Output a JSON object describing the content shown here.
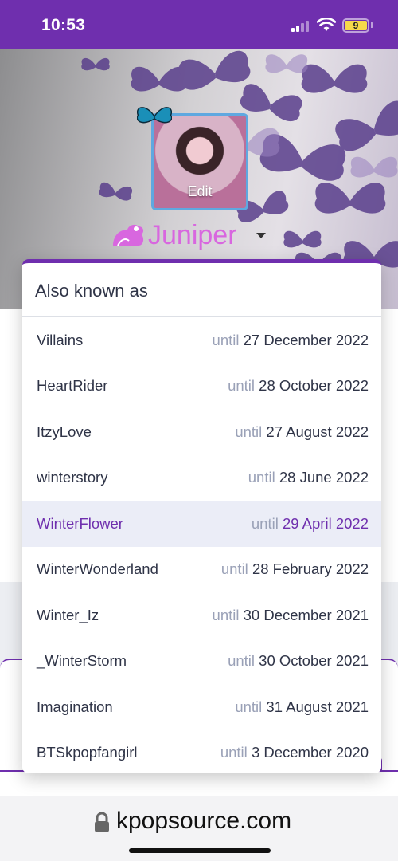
{
  "status_bar": {
    "time": "10:53",
    "battery_level": "9"
  },
  "profile": {
    "avatar_edit_label": "Edit",
    "username": "Juniper",
    "username_color": "#d867df"
  },
  "aka_dropdown": {
    "title": "Also known as",
    "until_word": "until",
    "accent_color": "#6f2fae",
    "items": [
      {
        "name": "Villains",
        "date": "27 December 2022",
        "active": false
      },
      {
        "name": "HeartRider",
        "date": "28 October 2022",
        "active": false
      },
      {
        "name": "ItzyLove",
        "date": "27 August 2022",
        "active": false
      },
      {
        "name": "winterstory",
        "date": "28 June 2022",
        "active": false
      },
      {
        "name": "WinterFlower",
        "date": "29 April 2022",
        "active": true
      },
      {
        "name": "WinterWonderland",
        "date": "28 February 2022",
        "active": false
      },
      {
        "name": "Winter_Iz",
        "date": "30 December 2021",
        "active": false
      },
      {
        "name": "_WinterStorm",
        "date": "30 October 2021",
        "active": false
      },
      {
        "name": "Imagination",
        "date": "31 August 2021",
        "active": false
      },
      {
        "name": "BTSkpopfangirl",
        "date": "3 December 2020",
        "active": false
      }
    ]
  },
  "browser": {
    "url": "kpopsource.com"
  }
}
